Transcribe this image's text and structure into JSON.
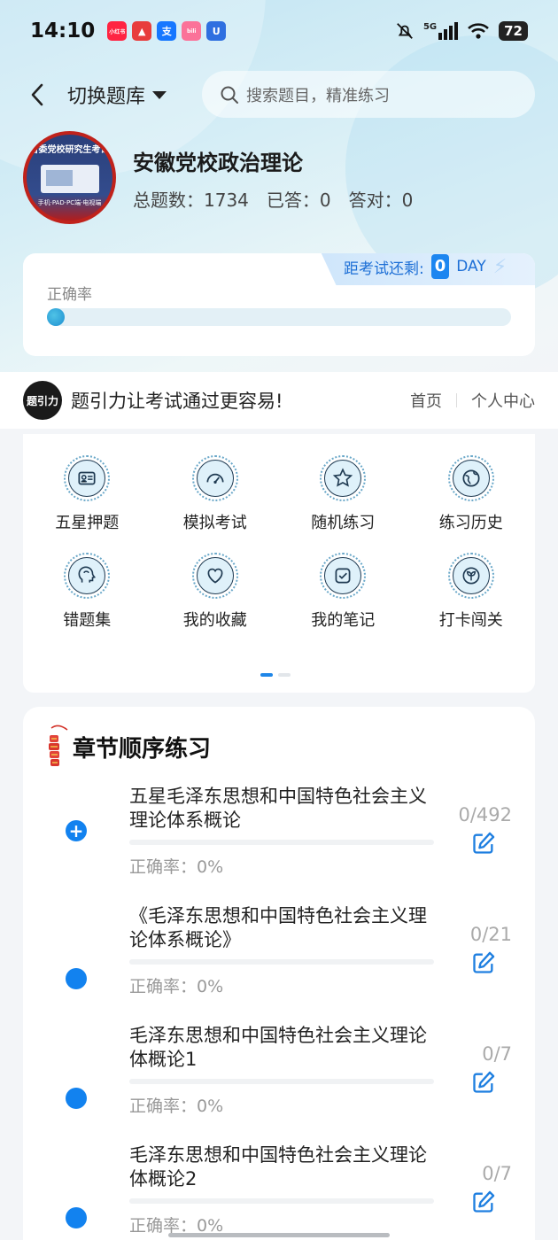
{
  "status_bar": {
    "time": "14:10",
    "apps": [
      {
        "icon": "xiaohongshu-icon",
        "text": "小红书",
        "color": "#ff2442"
      },
      {
        "icon": "arrow-app-icon",
        "text": "▲",
        "color": "#e83c3c"
      },
      {
        "icon": "alipay-icon",
        "text": "支",
        "color": "#1677ff"
      },
      {
        "icon": "bilibili-icon",
        "text": "bili",
        "color": "#fb7299"
      },
      {
        "icon": "shield-app-icon",
        "text": "U",
        "color": "#2f6fe0"
      }
    ],
    "network": "5G",
    "battery": "72"
  },
  "header": {
    "switch_label": "切换题库",
    "search_placeholder": "搜索题目，精准练习"
  },
  "bank": {
    "cover_title": "省委党校研究生考试",
    "cover_foot": "手机·PAD·PC端·电视端",
    "title": "安徽党校政治理论",
    "total_label": "总题数：1734",
    "answered_label": "已答：0",
    "correct_label": "答对：0"
  },
  "accuracy": {
    "label": "正确率",
    "progress": 0,
    "countdown_label": "距考试还剩:",
    "days": "0",
    "day_unit": "DAY"
  },
  "banner": {
    "logo": "题引力",
    "slogan": "题引力让考试通过更容易!",
    "home": "首页",
    "profile": "个人中心"
  },
  "functions": [
    {
      "label": "五星押题",
      "icon": "id-card-icon"
    },
    {
      "label": "模拟考试",
      "icon": "speedometer-icon"
    },
    {
      "label": "随机练习",
      "icon": "star-icon"
    },
    {
      "label": "练习历史",
      "icon": "globe-icon"
    },
    {
      "label": "错题集",
      "icon": "head-icon"
    },
    {
      "label": "我的收藏",
      "icon": "heart-icon"
    },
    {
      "label": "我的笔记",
      "icon": "note-check-icon"
    },
    {
      "label": "打卡闯关",
      "icon": "sprout-icon"
    }
  ],
  "pager": {
    "pages": 2,
    "active": 0
  },
  "chapters": {
    "title": "章节顺序练习",
    "items": [
      {
        "name": "五星毛泽东思想和中国特色社会主义理论体系概论",
        "accuracy": "正确率：0%",
        "count": "0/492",
        "expandable": true
      },
      {
        "name": "《毛泽东思想和中国特色社会主义理论体系概论》",
        "accuracy": "正确率：0%",
        "count": "0/21",
        "expandable": false
      },
      {
        "name": "毛泽东思想和中国特色社会主义理论体概论1",
        "accuracy": "正确率：0%",
        "count": "0/7",
        "expandable": false
      },
      {
        "name": "毛泽东思想和中国特色社会主义理论体概论2",
        "accuracy": "正确率：0%",
        "count": "0/7",
        "expandable": false
      }
    ]
  },
  "colors": {
    "accent": "#1282ef",
    "countdown_text": "#1d6fd6",
    "cover_red": "#c0221b"
  }
}
